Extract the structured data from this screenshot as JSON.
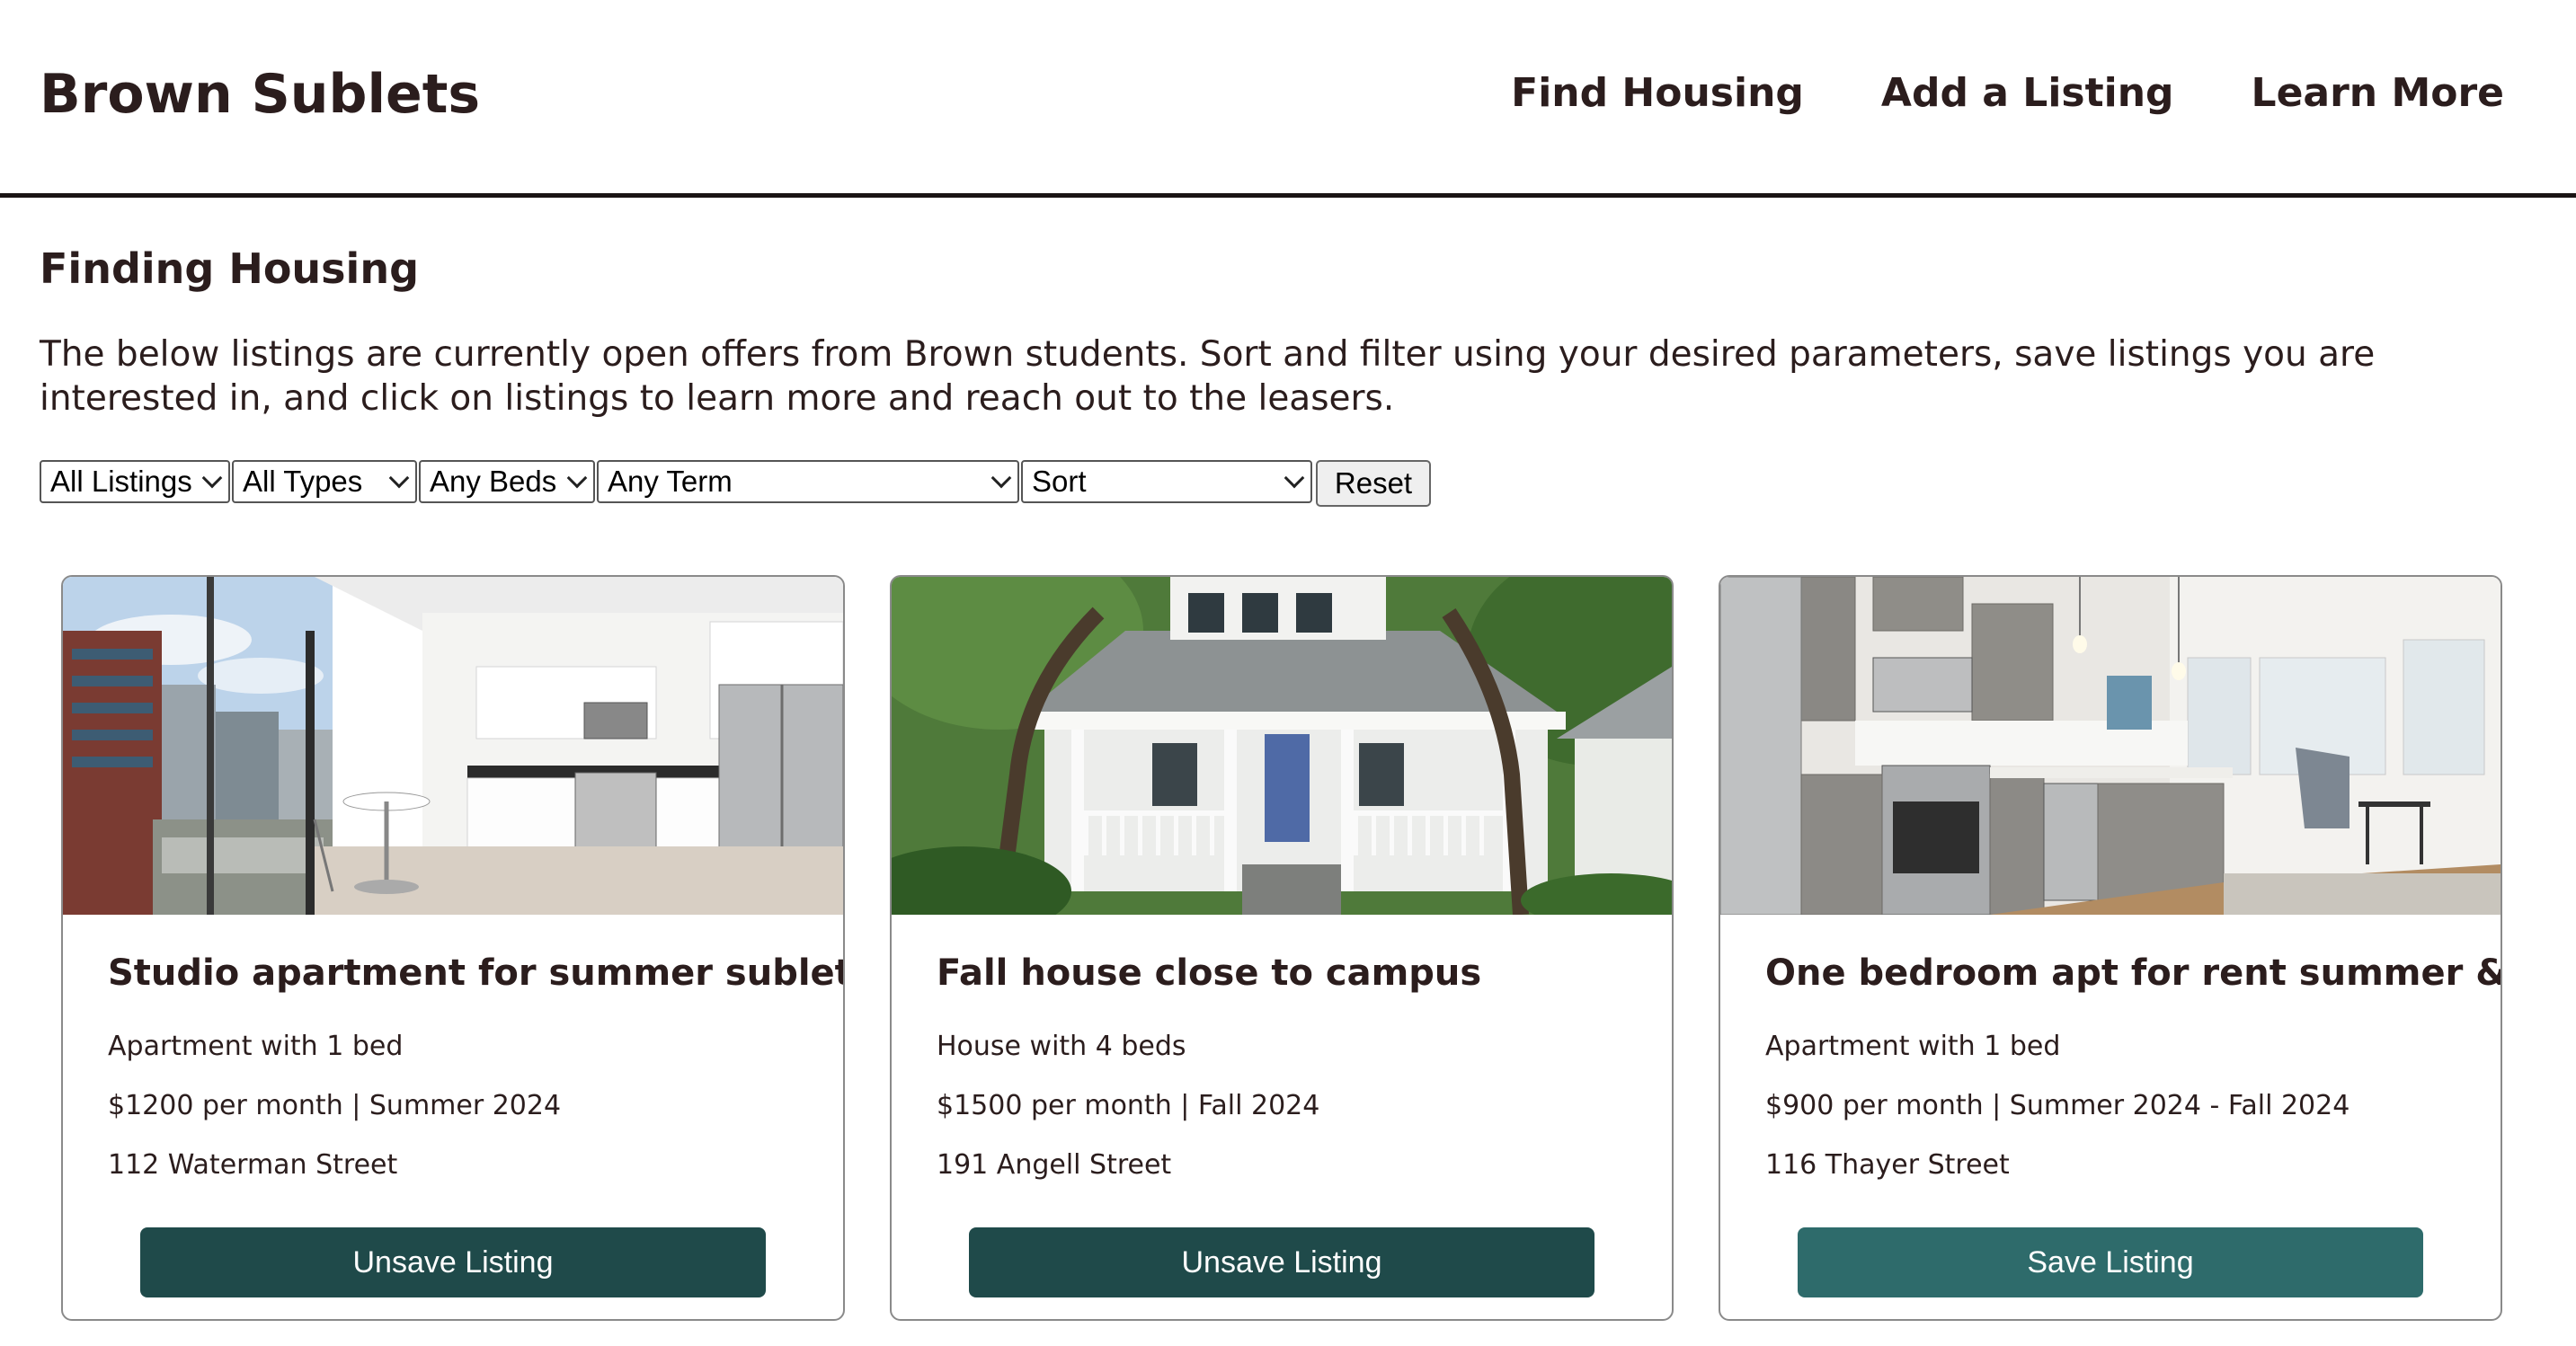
{
  "header": {
    "brand": "Brown Sublets",
    "nav": [
      {
        "label": "Find Housing"
      },
      {
        "label": "Add a Listing"
      },
      {
        "label": "Learn More"
      }
    ]
  },
  "main": {
    "title": "Finding Housing",
    "intro": "The below listings are currently open offers from Brown students. Sort and filter using your desired parameters, save listings you are interested in, and click on listings to learn more and reach out to the leasers."
  },
  "filters": {
    "listings": "All Listings",
    "types": "All Types",
    "beds": "Any Beds",
    "term": "Any Term",
    "sort": "Sort",
    "reset_label": "Reset"
  },
  "listings": [
    {
      "title": "Studio apartment for summer sublet",
      "type_line": "Apartment with 1 bed",
      "price_line": "$1200 per month | Summer 2024",
      "address": "112 Waterman Street",
      "button_label": "Unsave Listing",
      "button_color": "#1f4a4a",
      "image": "modern-kitchen-city-view"
    },
    {
      "title": "Fall house close to campus",
      "type_line": "House with 4 beds",
      "price_line": "$1500 per month | Fall 2024",
      "address": "191 Angell Street",
      "button_label": "Unsave Listing",
      "button_color": "#1f4a4a",
      "image": "white-house-porch"
    },
    {
      "title": "One bedroom apt for rent summer & fall",
      "type_line": "Apartment with 1 bed",
      "price_line": "$900 per month | Summer 2024 - Fall 2024",
      "address": "116 Thayer Street",
      "button_label": "Save Listing",
      "button_color": "#2e6b6b",
      "image": "gray-kitchen-living-room"
    }
  ]
}
